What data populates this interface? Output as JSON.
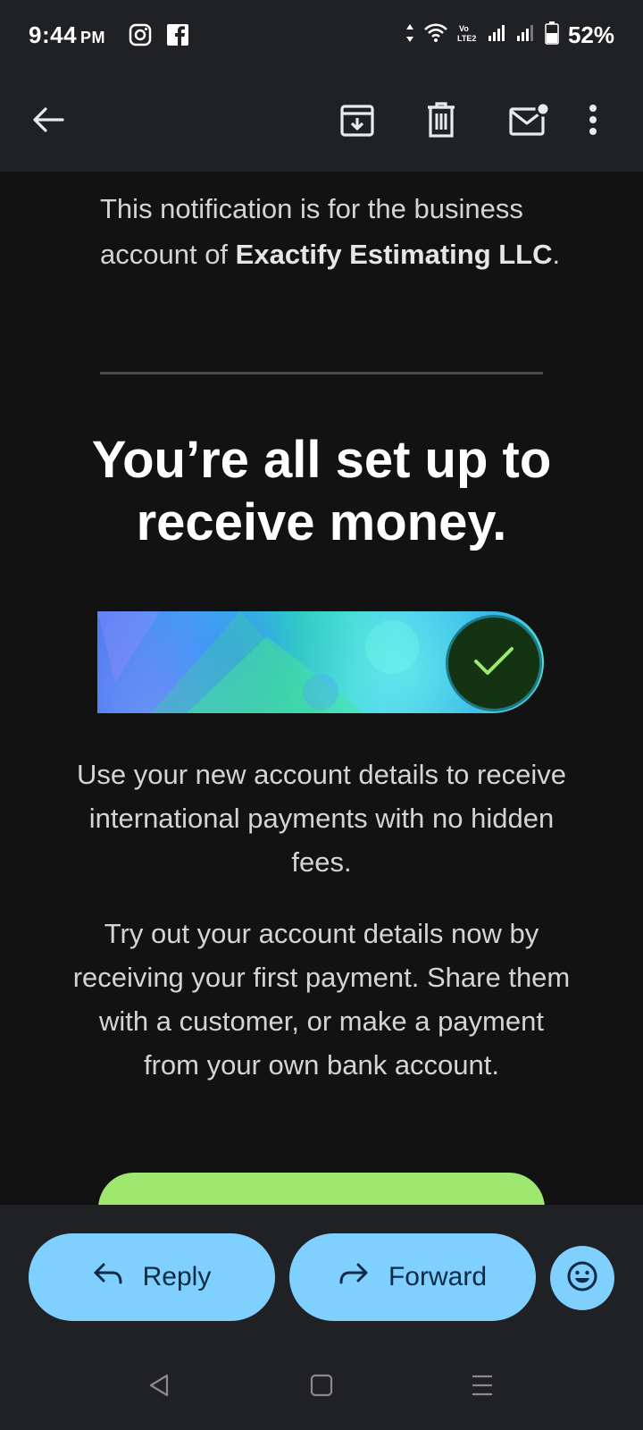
{
  "status_bar": {
    "time": "9:44",
    "ampm": "PM",
    "battery": "52%",
    "left_icons": [
      "instagram-icon",
      "facebook-icon"
    ],
    "right_icons": [
      "data-arrows-icon",
      "wifi-icon",
      "volte-icon",
      "signal-icon",
      "signal-icon",
      "battery-icon"
    ]
  },
  "toolbar": {
    "back_icon": "arrow-left-icon",
    "actions": [
      "archive-icon",
      "delete-icon",
      "mark-unread-icon",
      "more-vert-icon"
    ]
  },
  "email": {
    "notice_prefix": "This notification is for the business account of ",
    "business_name": "Exactify Estimating LLC",
    "notice_suffix": ".",
    "headline": "You’re all set up to receive money.",
    "paragraph_1": "Use your new account details to receive international payments with no hidden fees.",
    "paragraph_2": "Try out your account details now by receiving your first payment. Share them with a customer, or make a payment from your own bank account.",
    "banner_icon": "checkmark-icon"
  },
  "actions": {
    "reply_label": "Reply",
    "forward_label": "Forward",
    "emoji_icon": "emoji-icon"
  },
  "colors": {
    "status_bar_bg": "#202124",
    "content_bg": "#121212",
    "pill_bg": "#7fcfff",
    "cta_green": "#9fe870",
    "check_green": "#9fe870"
  }
}
